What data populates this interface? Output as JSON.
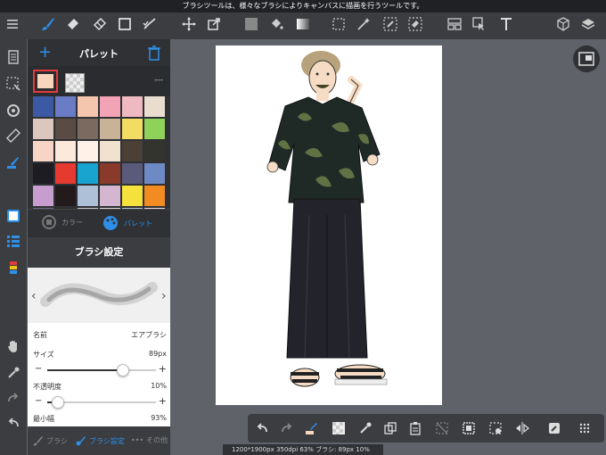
{
  "tooltip": "ブラシツールは、様々なブラシによりキャンバスに描画を行うツールです。",
  "toolbar": {
    "items": [
      "menu-icon",
      "brush-icon",
      "eraser-icon",
      "fill-eraser-icon",
      "rectangle-icon",
      "magic-brush-icon",
      "move-icon",
      "transform-icon",
      "fill-color-icon",
      "bucket-icon",
      "gradient-icon",
      "select-rect-icon",
      "magic-wand-icon",
      "select-pen-icon",
      "select-eraser-icon",
      "frame-icon",
      "operation-icon",
      "text-icon",
      "3d-icon",
      "layers-icon"
    ]
  },
  "palette": {
    "title": "パレット",
    "dash": "---",
    "current_color": "#f7d6bd",
    "colors": [
      "#3b5aa3",
      "#6b7cc6",
      "#f3c6ad",
      "#f2a3b6",
      "#efb9c1",
      "#e9ddcf",
      "#dcc7be",
      "#5a4b44",
      "#7a6a5f",
      "#c9b397",
      "#f3dc64",
      "#8fd25a",
      "#f6d5c4",
      "#fde9dc",
      "#fff1e8",
      "#f0e2cf",
      "#4b3f36",
      "#34342f",
      "#1c1c22",
      "#e53a2f",
      "#19a3cf",
      "#8a3a2a",
      "#5a5a7a",
      "#6e8ac4",
      "#c79dd0",
      "#231b1b",
      "#aebfd8",
      "#d5b6d0",
      "#f5e13b",
      "#f28b21",
      "#6a6e8a",
      "#2e2a2a",
      "#c9c9d2",
      "#e8e0d8",
      "#b0c4e0",
      "#ece0f0"
    ],
    "tab_color_label": "カラー",
    "tab_palette_label": "パレット"
  },
  "brush": {
    "title": "ブラシ設定",
    "name_label": "名前",
    "name_value": "エアブラシ",
    "size_label": "サイズ",
    "size_value": "89px",
    "size_level": 0.7,
    "opacity_label": "不透明度",
    "opacity_value": "10%",
    "opacity_level": 0.1,
    "min_width_label": "最小幅",
    "min_width_value": "93%",
    "tab_brush": "ブラシ",
    "tab_settings": "ブラシ設定",
    "tab_other": "その他"
  },
  "status": "1200*1900px 350dpi 63% ブラシ: 89px 10%",
  "colors": {
    "accent": "#2f8fe8",
    "toolbar_bg": "#3b3d41",
    "workspace_bg": "#5f6369"
  }
}
